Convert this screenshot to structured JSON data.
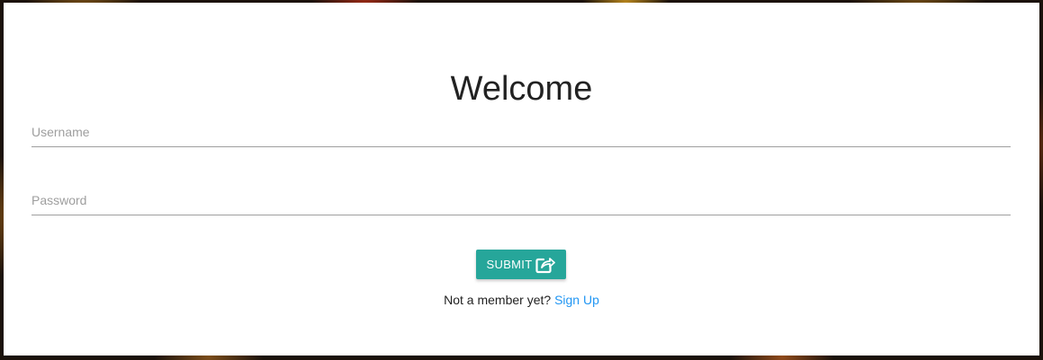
{
  "form": {
    "title": "Welcome",
    "username_placeholder": "Username",
    "username_value": "",
    "password_placeholder": "Password",
    "password_value": "",
    "submit_label": "SUBMIT",
    "submit_icon": "share-arrow-icon",
    "signup_prompt": "Not a member yet?",
    "signup_link": "Sign Up"
  },
  "colors": {
    "button": "#26a69a",
    "link": "#2196f3",
    "card_background": "#ffffff"
  }
}
